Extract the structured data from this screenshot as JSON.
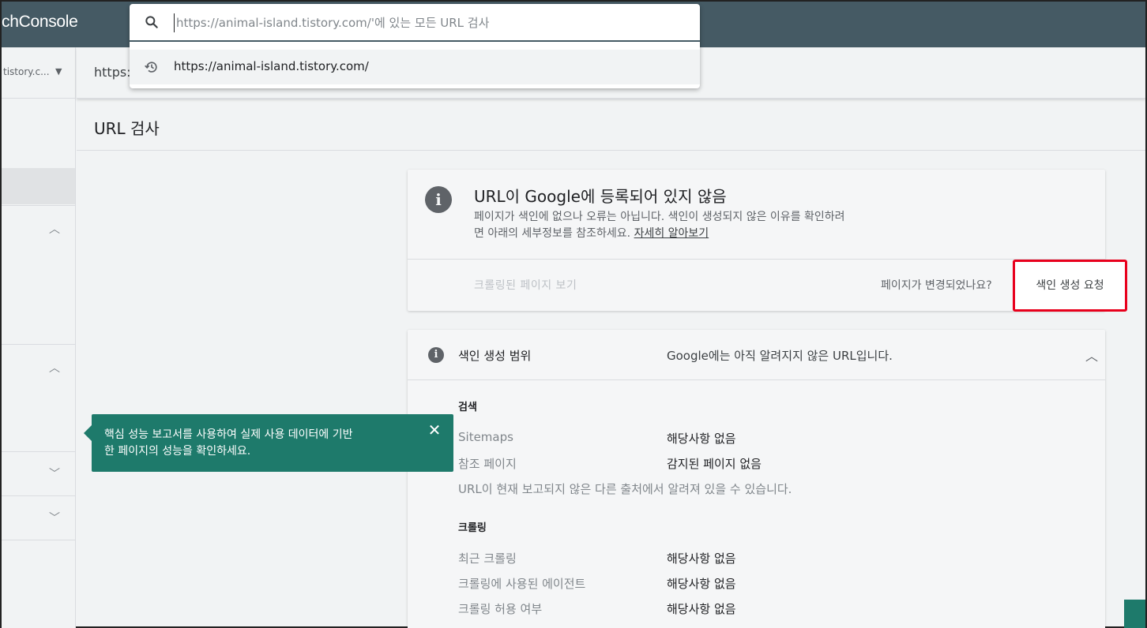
{
  "header": {
    "app_title": "chConsole"
  },
  "search": {
    "placeholder": "https://animal-island.tistory.com/'에 있는 모든 URL 검사",
    "suggestion": "https://animal-island.tistory.com/",
    "icon": "search-icon",
    "history_icon": "history-icon"
  },
  "sidebar": {
    "property_text": "tistory.c..."
  },
  "urlbar": {
    "text": "https:/"
  },
  "page": {
    "title": "URL 검사"
  },
  "status": {
    "title": "URL이 Google에 등록되어 있지 않음",
    "desc_line1": "페이지가 색인에 없으나 오류는 아닙니다. 색인이 생성되지 않은 이유를 확인하려",
    "desc_line2": "면 아래의 세부정보를 참조하세요.",
    "learn_more": "자세히 알아보기",
    "view_crawled": "크롤링된 페이지 보기",
    "changed_question": "페이지가 변경되었나요?",
    "request_indexing": "색인 생성 요청"
  },
  "coverage": {
    "label": "색인 생성 범위",
    "value": "Google에는 아직 알려지지 않은 URL입니다.",
    "discovery": {
      "title": "검색",
      "rows": [
        {
          "label": "Sitemaps",
          "value": "해당사항 없음"
        },
        {
          "label": "참조 페이지",
          "value": "감지된 페이지 없음"
        }
      ],
      "note": "URL이 현재 보고되지 않은 다른 출처에서 알려져 있을 수 있습니다."
    },
    "crawl": {
      "title": "크롤링",
      "rows": [
        {
          "label": "최근 크롤링",
          "value": "해당사항 없음"
        },
        {
          "label": "크롤링에 사용된 에이전트",
          "value": "해당사항 없음"
        },
        {
          "label": "크롤링 허용 여부",
          "value": "해당사항 없음"
        }
      ]
    }
  },
  "tooltip": {
    "line1": "핵심 성능 보고서를 사용하여 실제 사용 데이터에 기반",
    "line2": "한 페이지의 성능을 확인하세요."
  },
  "colors": {
    "topbar": "#455a64",
    "tooltip": "#1e7a6b",
    "highlight": "#e8001c"
  }
}
